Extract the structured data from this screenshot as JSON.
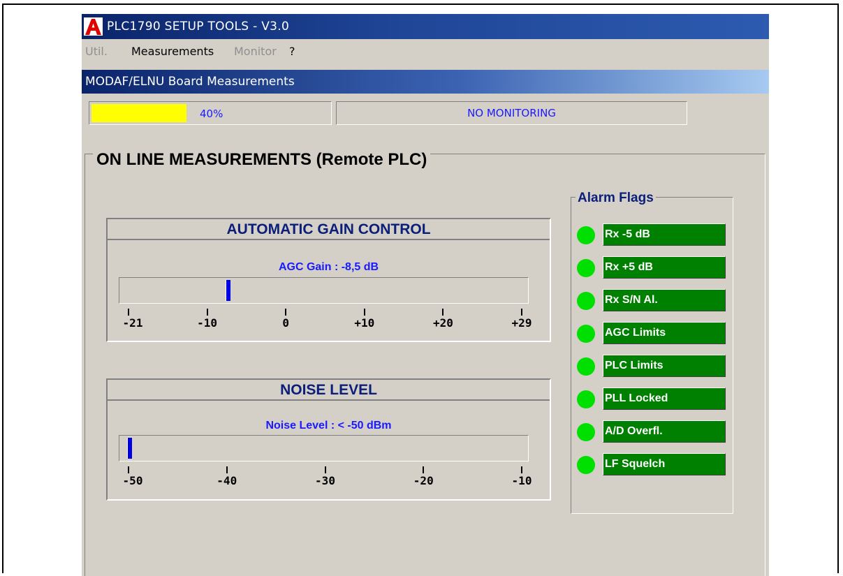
{
  "window": {
    "title": "PLC1790 SETUP TOOLS  -  V3.0",
    "logo_letter": "A"
  },
  "menu": [
    {
      "label": "Util.",
      "enabled": false
    },
    {
      "label": "Measurements",
      "enabled": true
    },
    {
      "label": "Monitor",
      "enabled": false
    },
    {
      "label": "?",
      "enabled": true
    }
  ],
  "subwindow": {
    "title": "MODAF/ELNU Board Measurements"
  },
  "status": {
    "progress_percent": 40,
    "progress_text": "40%",
    "monitoring_text": "NO MONITORING"
  },
  "group_title": "ON LINE MEASUREMENTS (Remote PLC)",
  "gauges": {
    "agc": {
      "title": "AUTOMATIC GAIN CONTROL",
      "readout": "AGC Gain : -8,5 dB",
      "value": -8.5,
      "min": -21,
      "max": 29,
      "ticks": [
        "-21",
        "-10",
        "0",
        "+10",
        "+20",
        "+29"
      ]
    },
    "noise": {
      "title": "NOISE LEVEL",
      "readout": "Noise Level : < -50 dBm",
      "value": -50,
      "min": -50,
      "max": -10,
      "ticks": [
        "-50",
        "-40",
        "-30",
        "-20",
        "-10"
      ]
    }
  },
  "alarms": {
    "title": "Alarm Flags",
    "flags": [
      {
        "label": "Rx -5 dB",
        "led": "green"
      },
      {
        "label": "Rx +5 dB",
        "led": "green"
      },
      {
        "label": "Rx S/N Al.",
        "led": "green"
      },
      {
        "label": "AGC Limits",
        "led": "green"
      },
      {
        "label": "PLC Limits",
        "led": "green"
      },
      {
        "label": "PLL Locked",
        "led": "green"
      },
      {
        "label": "A/D Overfl.",
        "led": "green"
      },
      {
        "label": "LF Squelch",
        "led": "green"
      }
    ]
  },
  "colors": {
    "titlebar": "#0a246a",
    "progress_fill": "#ffff00",
    "status_text": "#1a1aff",
    "led_on": "#00e000",
    "flag_bg": "#008000",
    "gauge_thumb": "#0000e6"
  }
}
